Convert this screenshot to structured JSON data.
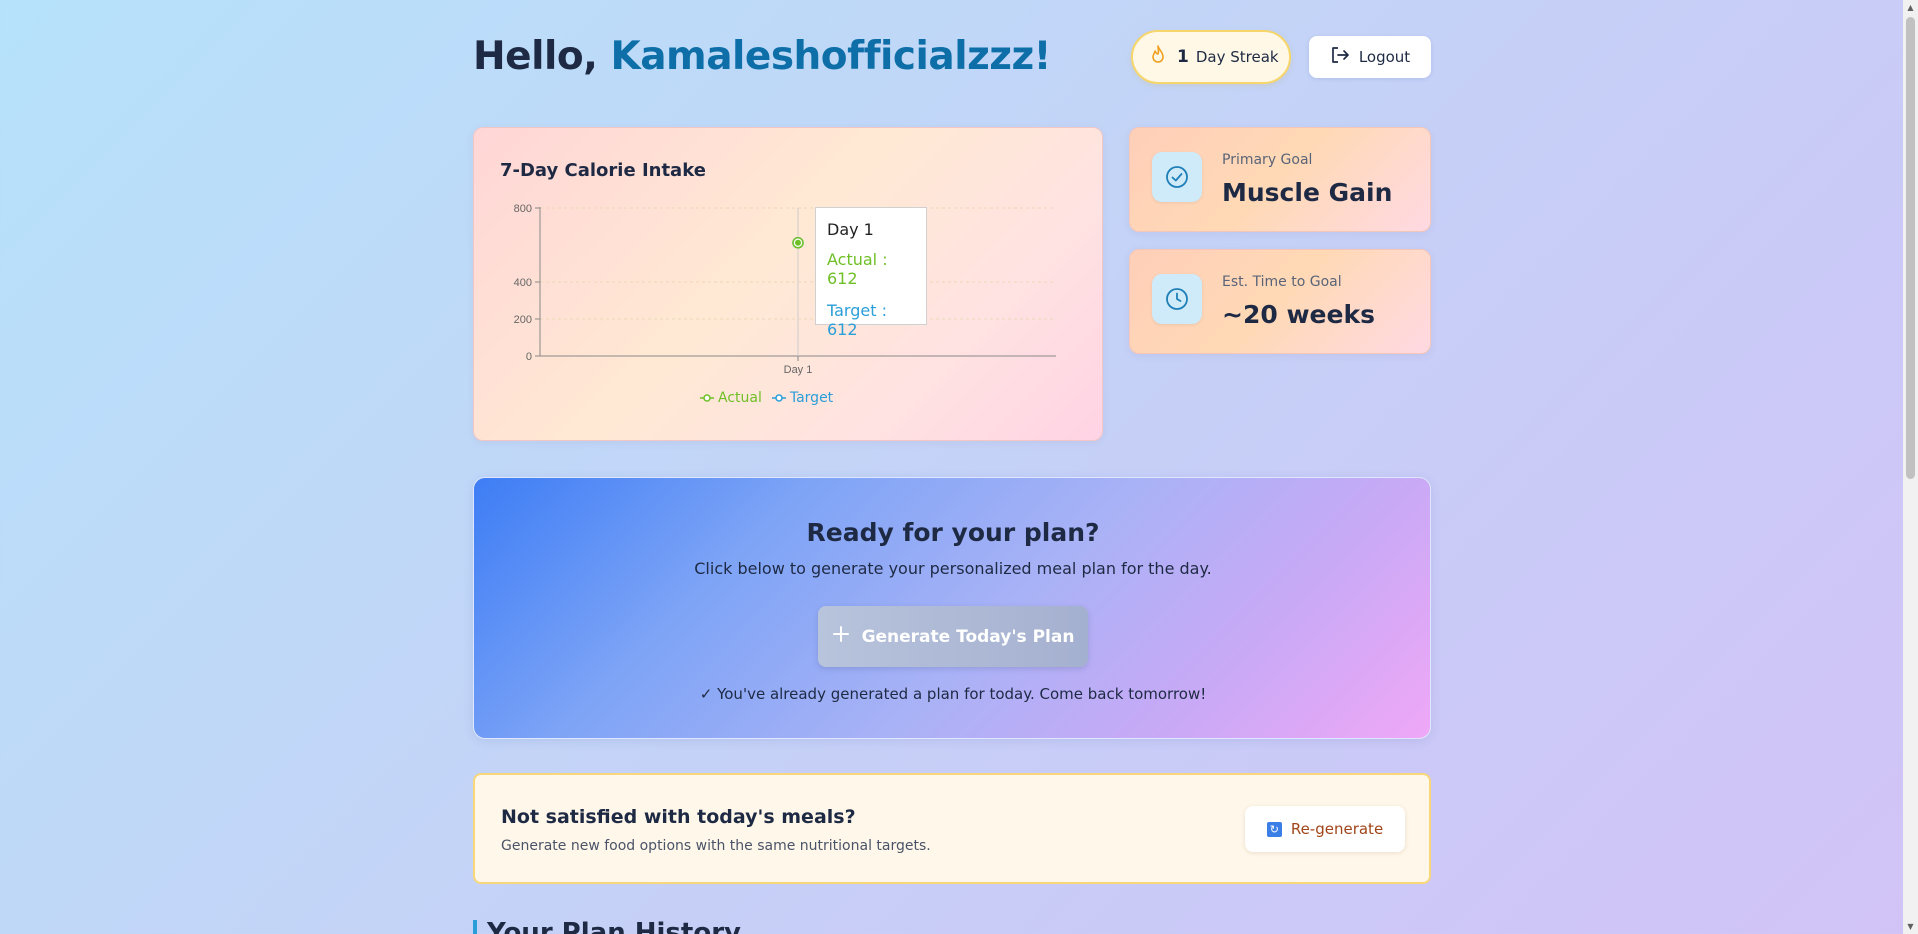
{
  "header": {
    "greeting_prefix": "Hello, ",
    "username": "Kamaleshofficialzzz!",
    "streak_count": "1",
    "streak_label": "Day Streak",
    "logout_label": "Logout"
  },
  "chart_card": {
    "title": "7-Day Calorie Intake",
    "tooltip": {
      "day": "Day 1",
      "actual": "Actual : 612",
      "target": "Target : 612"
    },
    "legend": {
      "actual": "Actual",
      "target": "Target"
    }
  },
  "chart_data": {
    "type": "line",
    "title": "7-Day Calorie Intake",
    "x": [
      "Day 1"
    ],
    "series": [
      {
        "name": "Actual",
        "values": [
          612
        ],
        "color": "#6fbf26"
      },
      {
        "name": "Target",
        "values": [
          612
        ],
        "color": "#2a9ed8"
      }
    ],
    "yticks": [
      0,
      200,
      400,
      800
    ],
    "ylim": [
      0,
      800
    ],
    "legend": "bottom",
    "grid": true
  },
  "goals": {
    "primary": {
      "label": "Primary Goal",
      "value": "Muscle Gain"
    },
    "time": {
      "label": "Est. Time to Goal",
      "value": "~20 weeks"
    }
  },
  "plan": {
    "title": "Ready for your plan?",
    "subtitle": "Click below to generate your personalized meal plan for the day.",
    "button_label": "Generate Today's Plan",
    "note": "✓ You've already generated a plan for today. Come back tomorrow!"
  },
  "regenerate": {
    "title": "Not satisfied with today's meals?",
    "subtitle": "Generate new food options with the same nutritional targets.",
    "button_label": "Re-generate"
  },
  "history": {
    "title": "Your Plan History"
  },
  "colors": {
    "accent_blue": "#0e6fa8",
    "actual_green": "#6fbf26",
    "target_blue": "#2a9ed8",
    "regen_text": "#a1451a"
  }
}
